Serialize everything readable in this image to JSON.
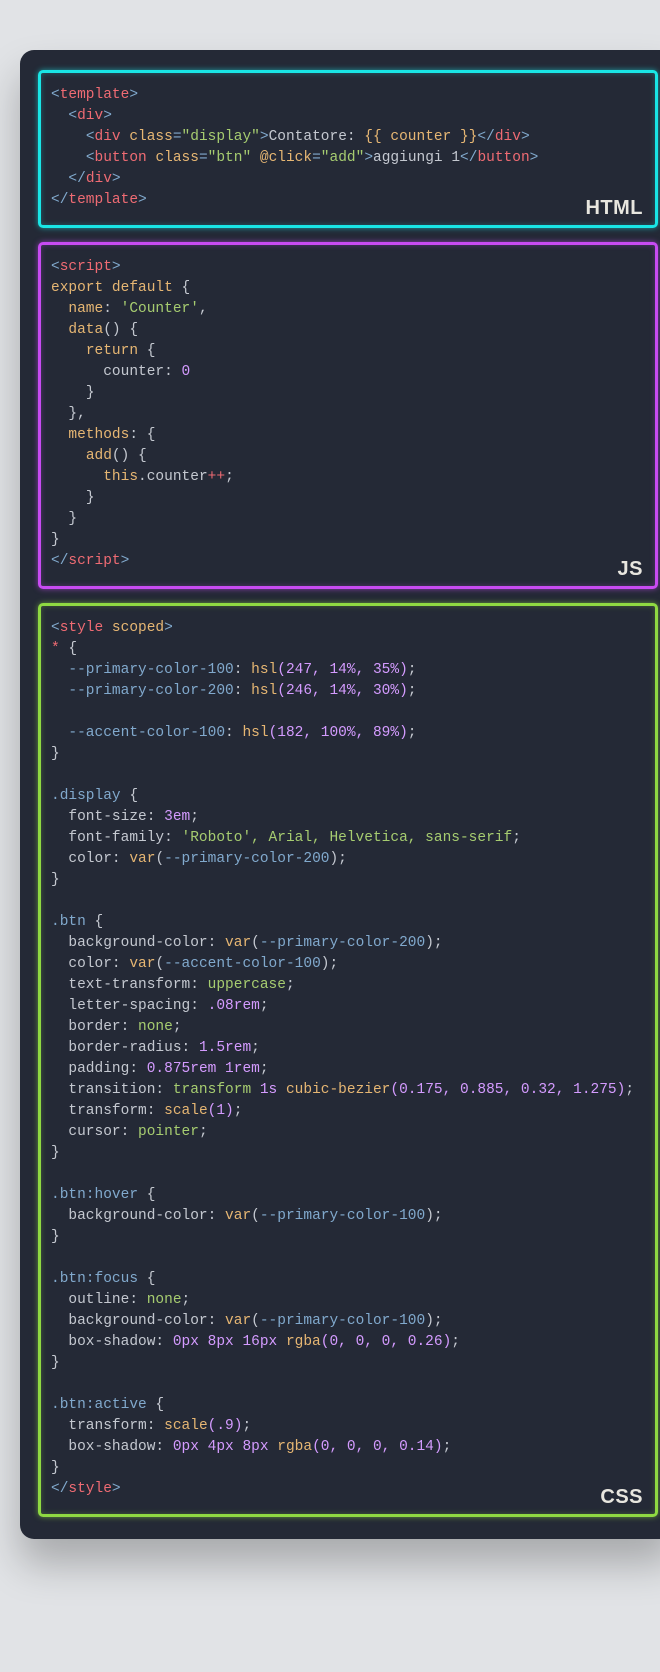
{
  "badges": {
    "html": "HTML",
    "js": "JS",
    "css": "CSS"
  },
  "code_html": {
    "l1_tag": "template",
    "l2_tag": "div",
    "l3_tag": "div",
    "l3_attr": "class",
    "l3_val": "\"display\"",
    "l3_text": "Contatore: ",
    "l3_int": "{{ counter }}",
    "l4_tag": "button",
    "l4_a1": "class",
    "l4_v1": "\"btn\"",
    "l4_a2": "@click",
    "l4_v2": "\"add\"",
    "l4_text": "aggiungi 1",
    "l5_tag": "div",
    "l6_tag": "template"
  },
  "code_js": {
    "l1_tag": "script",
    "l2_a": "export",
    "l2_b": "default",
    "l2_c": "{",
    "l3_k": "name",
    "l3_v": "'Counter'",
    "l3_c": ",",
    "l4_fn": "data",
    "l4_p": "()",
    "l4_b": "{",
    "l5_kw": "return",
    "l5_b": "{",
    "l6_k": "counter",
    "l6_c": ":",
    "l6_v": "0",
    "l7": "}",
    "l8": "},",
    "l9_k": "methods",
    "l9_c": ":",
    "l9_b": "{",
    "l10_fn": "add",
    "l10_p": "()",
    "l10_b": "{",
    "l11_a": "this",
    "l11_b": ".counter",
    "l11_c": "++",
    "l12": "}",
    "l13": "}",
    "l14": "}",
    "l15_tag": "script"
  },
  "code_css": {
    "l1_tag": "style",
    "l1_attr": "scoped",
    "l2_sel": "*",
    "l2_b": "{",
    "l3_var": "--primary-color-100",
    "l3_c": ":",
    "l3_fn": "hsl",
    "l3_args": "(247, 14%, 35%)",
    "l3_e": ";",
    "l4_var": "--primary-color-200",
    "l4_c": ":",
    "l4_fn": "hsl",
    "l4_args": "(246, 14%, 30%)",
    "l4_e": ";",
    "l6_var": "--accent-color-100",
    "l6_c": ":",
    "l6_fn": "hsl",
    "l6_args": "(182, 100%, 89%)",
    "l6_e": ";",
    "l7": "}",
    "d_sel": ".display",
    "d_b": "{",
    "d1_p": "font-size",
    "d1_v": "3em",
    "d2_p": "font-family",
    "d2_v": "'Roboto', Arial, Helvetica, sans-serif",
    "d3_p": "color",
    "d3_fn": "var",
    "d3_arg": "--primary-color-200",
    "d_end": "}",
    "b_sel": ".btn",
    "b_b": "{",
    "b1_p": "background-color",
    "b1_fn": "var",
    "b1_arg": "--primary-color-200",
    "b2_p": "color",
    "b2_fn": "var",
    "b2_arg": "--accent-color-100",
    "b3_p": "text-transform",
    "b3_v": "uppercase",
    "b4_p": "letter-spacing",
    "b4_v": ".08rem",
    "b5_p": "border",
    "b5_v": "none",
    "b6_p": "border-radius",
    "b6_v": "1.5rem",
    "b7_p": "padding",
    "b7_v": "0.875rem 1rem",
    "b8_p": "transition",
    "b8_v1": "transform",
    "b8_v2": "1s",
    "b8_fn": "cubic-bezier",
    "b8_arg": "(0.175, 0.885, 0.32, 1.275)",
    "b9_p": "transform",
    "b9_fn": "scale",
    "b9_arg": "(1)",
    "b10_p": "cursor",
    "b10_v": "pointer",
    "b_end": "}",
    "h_sel": ".btn:hover",
    "h_b": "{",
    "h1_p": "background-color",
    "h1_fn": "var",
    "h1_arg": "--primary-color-100",
    "h_end": "}",
    "f_sel": ".btn:focus",
    "f_b": "{",
    "f1_p": "outline",
    "f1_v": "none",
    "f2_p": "background-color",
    "f2_fn": "var",
    "f2_arg": "--primary-color-100",
    "f3_p": "box-shadow",
    "f3_v": "0px 8px 16px",
    "f3_fn": "rgba",
    "f3_arg": "(0, 0, 0, 0.26)",
    "f_end": "}",
    "a_sel": ".btn:active",
    "a_b": "{",
    "a1_p": "transform",
    "a1_fn": "scale",
    "a1_arg": "(.9)",
    "a2_p": "box-shadow",
    "a2_v": "0px 4px 8px",
    "a2_fn": "rgba",
    "a2_arg": "(0, 0, 0, 0.14)",
    "a_end": "}",
    "end_tag": "style"
  }
}
